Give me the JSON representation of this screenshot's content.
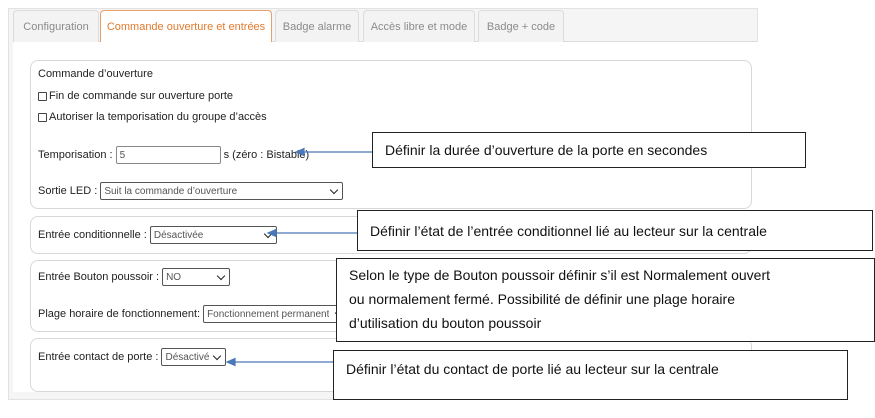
{
  "tabs": [
    {
      "label": "Configuration",
      "active": false
    },
    {
      "label": "Commande ouverture et entrées",
      "active": true
    },
    {
      "label": "Badge alarme",
      "active": false
    },
    {
      "label": "Accès libre et mode",
      "active": false
    },
    {
      "label": "Badge + code",
      "active": false
    }
  ],
  "commande": {
    "title": "Commande d’ouverture",
    "check_fin": "Fin de commande sur ouverture porte",
    "check_autoriser": "Autoriser la temporisation du groupe d’accès",
    "tempo_label": "Temporisation :",
    "tempo_value": "5",
    "tempo_unit": "s (zéro : Bistable)",
    "led_label": "Sortie LED :",
    "led_value": "Suit la commande d’ouverture"
  },
  "conditionnelle": {
    "label": "Entrée conditionnelle :",
    "value": "Désactivée"
  },
  "bouton": {
    "label": "Entrée Bouton poussoir :",
    "value": "NO",
    "plage_label": "Plage horaire de fonctionnement:",
    "plage_value": "Fonctionnement permanent"
  },
  "contact": {
    "label": "Entrée contact de porte :",
    "value": "Désactivé"
  },
  "callouts": {
    "duree": "Définir la durée d’ouverture de la porte en secondes",
    "conditionnel": "Définir l’état de l’entrée conditionnel lié au lecteur sur la centrale",
    "bouton_line1": "Selon le type de Bouton poussoir définir s’il est Normalement ouvert",
    "bouton_line2": "ou normalement fermé. Possibilité de définir une plage horaire",
    "bouton_line3": "d’utilisation du bouton poussoir",
    "contact": "Définir l’état du contact de porte lié au lecteur sur la centrale"
  },
  "colors": {
    "tab_active_text": "#e07b2d",
    "tab_active_border": "#e8a06a",
    "arrow": "#4a78b8"
  }
}
